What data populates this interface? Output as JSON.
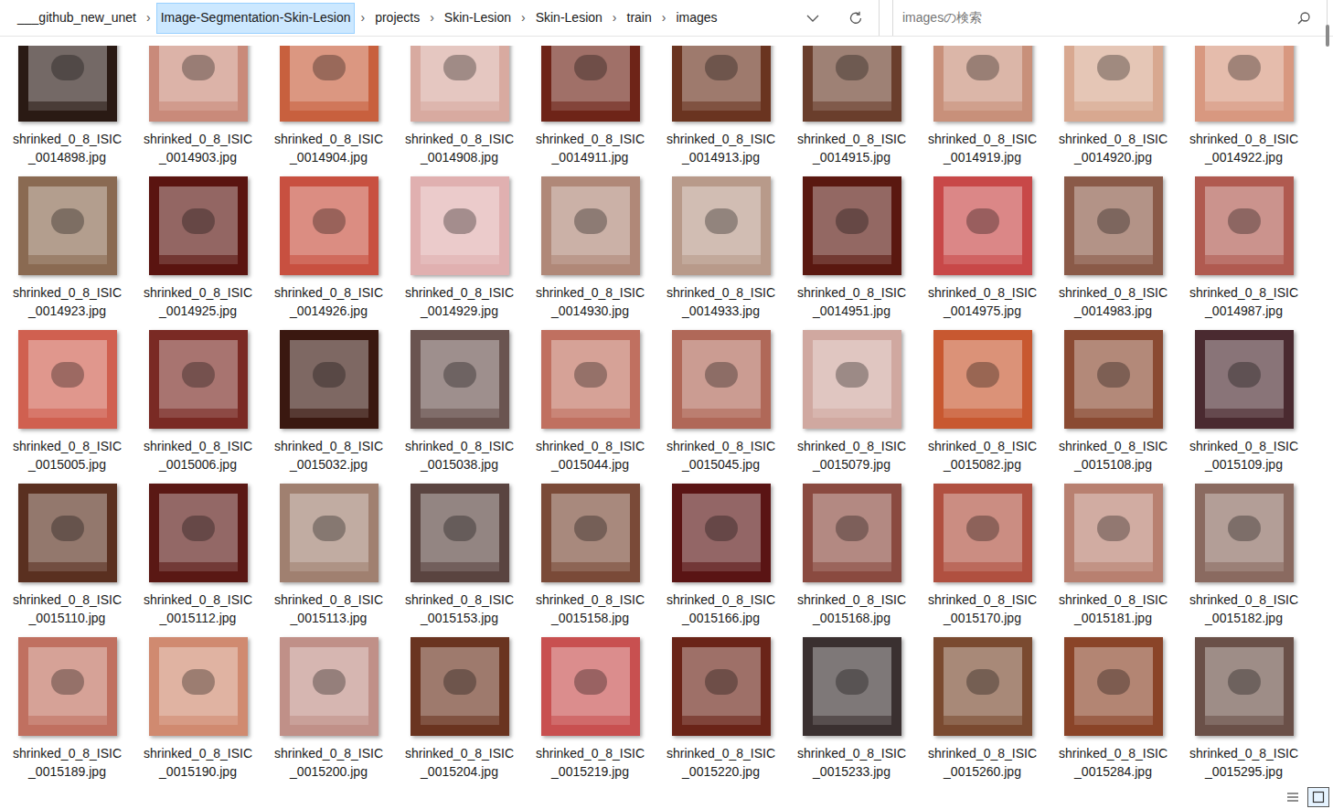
{
  "breadcrumb": {
    "separator": "›",
    "items": [
      {
        "label": "___github_new_unet",
        "selected": false
      },
      {
        "label": "Image-Segmentation-Skin-Lesion",
        "selected": true
      },
      {
        "label": "projects",
        "selected": false
      },
      {
        "label": "Skin-Lesion",
        "selected": false
      },
      {
        "label": "Skin-Lesion",
        "selected": false
      },
      {
        "label": "train",
        "selected": false
      },
      {
        "label": "images",
        "selected": false
      }
    ]
  },
  "search": {
    "placeholder": "imagesの検索"
  },
  "files": [
    {
      "name": "shrinked_0_8_ISIC_0014898.jpg",
      "color": "#2a1a14"
    },
    {
      "name": "shrinked_0_8_ISIC_0014903.jpg",
      "color": "#c98a7a"
    },
    {
      "name": "shrinked_0_8_ISIC_0014904.jpg",
      "color": "#c8603e"
    },
    {
      "name": "shrinked_0_8_ISIC_0014908.jpg",
      "color": "#d8aaa0"
    },
    {
      "name": "shrinked_0_8_ISIC_0014911.jpg",
      "color": "#6e2418"
    },
    {
      "name": "shrinked_0_8_ISIC_0014913.jpg",
      "color": "#6a3420"
    },
    {
      "name": "shrinked_0_8_ISIC_0014915.jpg",
      "color": "#6a3e2c"
    },
    {
      "name": "shrinked_0_8_ISIC_0014919.jpg",
      "color": "#c8907a"
    },
    {
      "name": "shrinked_0_8_ISIC_0014920.jpg",
      "color": "#d8a890"
    },
    {
      "name": "shrinked_0_8_ISIC_0014922.jpg",
      "color": "#d89880"
    },
    {
      "name": "shrinked_0_8_ISIC_0014923.jpg",
      "color": "#8a6a52"
    },
    {
      "name": "shrinked_0_8_ISIC_0014925.jpg",
      "color": "#5a1410"
    },
    {
      "name": "shrinked_0_8_ISIC_0014926.jpg",
      "color": "#c85040"
    },
    {
      "name": "shrinked_0_8_ISIC_0014929.jpg",
      "color": "#e0b0b0"
    },
    {
      "name": "shrinked_0_8_ISIC_0014930.jpg",
      "color": "#b08878"
    },
    {
      "name": "shrinked_0_8_ISIC_0014933.jpg",
      "color": "#b89a8a"
    },
    {
      "name": "shrinked_0_8_ISIC_0014951.jpg",
      "color": "#5a1810"
    },
    {
      "name": "shrinked_0_8_ISIC_0014975.jpg",
      "color": "#c84848"
    },
    {
      "name": "shrinked_0_8_ISIC_0014983.jpg",
      "color": "#8a5a48"
    },
    {
      "name": "shrinked_0_8_ISIC_0014987.jpg",
      "color": "#b05a50"
    },
    {
      "name": "shrinked_0_8_ISIC_0015005.jpg",
      "color": "#d06050"
    },
    {
      "name": "shrinked_0_8_ISIC_0015006.jpg",
      "color": "#7a2a24"
    },
    {
      "name": "shrinked_0_8_ISIC_0015032.jpg",
      "color": "#3a1810"
    },
    {
      "name": "shrinked_0_8_ISIC_0015038.jpg",
      "color": "#6a5450"
    },
    {
      "name": "shrinked_0_8_ISIC_0015044.jpg",
      "color": "#c07060"
    },
    {
      "name": "shrinked_0_8_ISIC_0015045.jpg",
      "color": "#b06858"
    },
    {
      "name": "shrinked_0_8_ISIC_0015079.jpg",
      "color": "#d0a8a0"
    },
    {
      "name": "shrinked_0_8_ISIC_0015082.jpg",
      "color": "#c85830"
    },
    {
      "name": "shrinked_0_8_ISIC_0015108.jpg",
      "color": "#8a4a32"
    },
    {
      "name": "shrinked_0_8_ISIC_0015109.jpg",
      "color": "#4a2a30"
    },
    {
      "name": "shrinked_0_8_ISIC_0015110.jpg",
      "color": "#5a3020"
    },
    {
      "name": "shrinked_0_8_ISIC_0015112.jpg",
      "color": "#5a1814"
    },
    {
      "name": "shrinked_0_8_ISIC_0015113.jpg",
      "color": "#a08070"
    },
    {
      "name": "shrinked_0_8_ISIC_0015153.jpg",
      "color": "#5a4440"
    },
    {
      "name": "shrinked_0_8_ISIC_0015158.jpg",
      "color": "#7a4a38"
    },
    {
      "name": "shrinked_0_8_ISIC_0015166.jpg",
      "color": "#5a1414"
    },
    {
      "name": "shrinked_0_8_ISIC_0015168.jpg",
      "color": "#8a4a40"
    },
    {
      "name": "shrinked_0_8_ISIC_0015170.jpg",
      "color": "#b05040"
    },
    {
      "name": "shrinked_0_8_ISIC_0015181.jpg",
      "color": "#b88070"
    },
    {
      "name": "shrinked_0_8_ISIC_0015182.jpg",
      "color": "#8a6a60"
    },
    {
      "name": "shrinked_0_8_ISIC_0015189.jpg",
      "color": "#c07060"
    },
    {
      "name": "shrinked_0_8_ISIC_0015190.jpg",
      "color": "#d08a70"
    },
    {
      "name": "shrinked_0_8_ISIC_0015200.jpg",
      "color": "#c09088"
    },
    {
      "name": "shrinked_0_8_ISIC_0015204.jpg",
      "color": "#6a3420"
    },
    {
      "name": "shrinked_0_8_ISIC_0015219.jpg",
      "color": "#c85050"
    },
    {
      "name": "shrinked_0_8_ISIC_0015220.jpg",
      "color": "#6a2418"
    },
    {
      "name": "shrinked_0_8_ISIC_0015233.jpg",
      "color": "#3a3030"
    },
    {
      "name": "shrinked_0_8_ISIC_0015260.jpg",
      "color": "#7a4a30"
    },
    {
      "name": "shrinked_0_8_ISIC_0015284.jpg",
      "color": "#8a4428"
    },
    {
      "name": "shrinked_0_8_ISIC_0015295.jpg",
      "color": "#6a5048"
    }
  ],
  "scrollbar": {
    "level": 0.97
  },
  "view_buttons": [
    {
      "kind": "details",
      "selected": false
    },
    {
      "kind": "icons",
      "selected": true
    }
  ]
}
